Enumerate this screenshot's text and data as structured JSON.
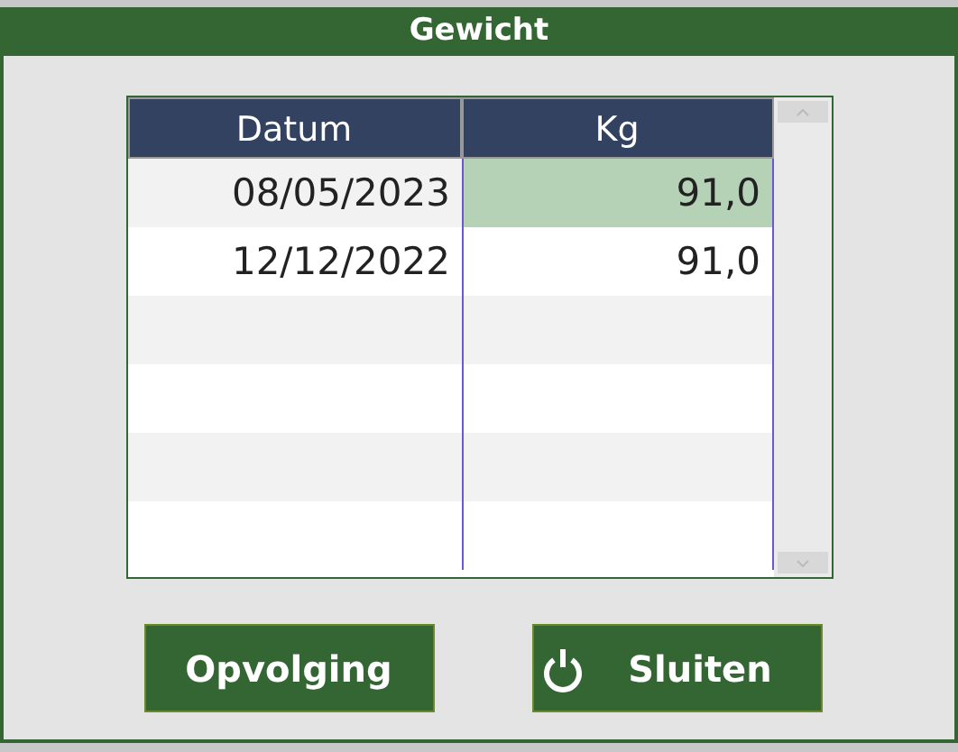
{
  "window": {
    "title": "Gewicht"
  },
  "table": {
    "columns": [
      "Datum",
      "Kg"
    ],
    "rows": [
      {
        "datum": "08/05/2023",
        "kg": "91,0",
        "selected": true
      },
      {
        "datum": "12/12/2022",
        "kg": "91,0",
        "selected": false
      }
    ]
  },
  "buttons": [
    {
      "kind": "plain",
      "label": "Opvolging"
    },
    {
      "kind": "power",
      "label": "Sluiten"
    }
  ]
}
